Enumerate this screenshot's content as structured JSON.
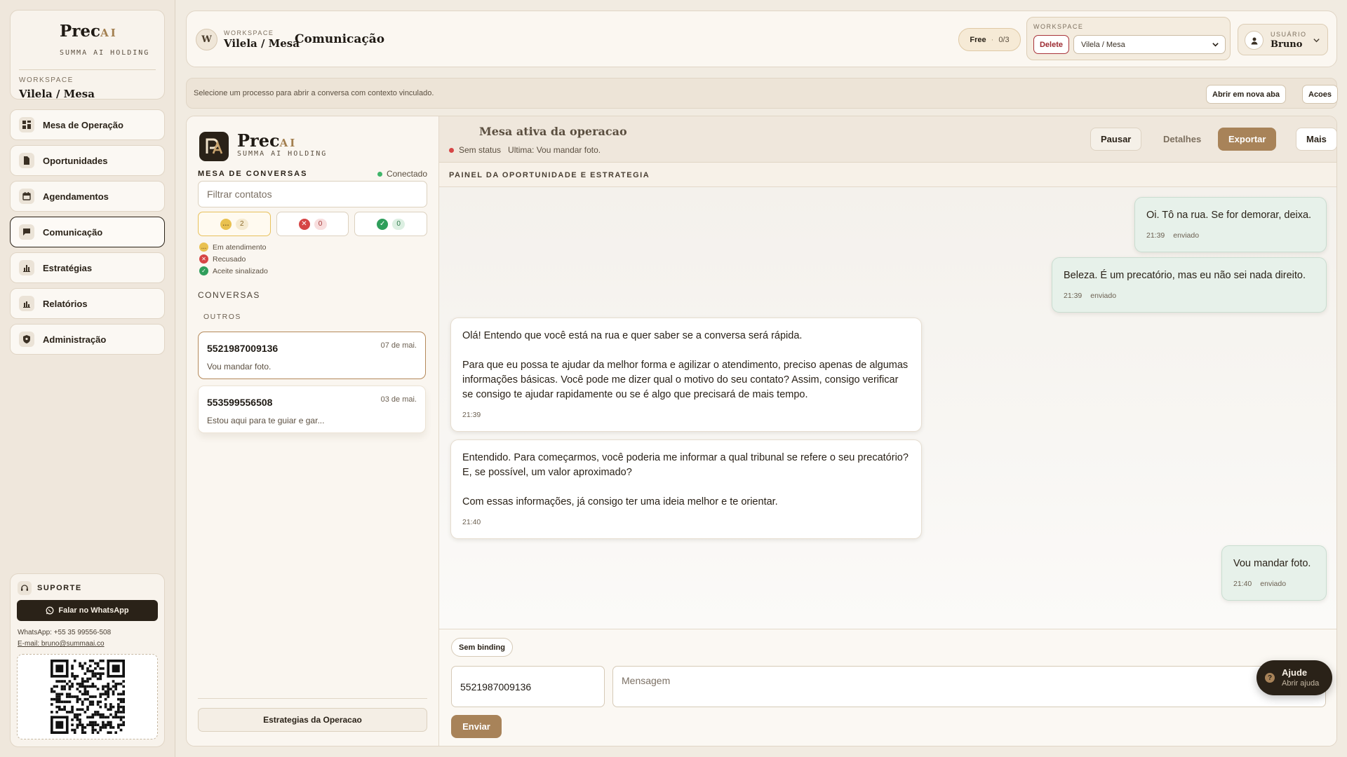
{
  "brand": {
    "name": "Prec",
    "name_ai": "AI",
    "subtitle": "SUMMA AI HOLDING",
    "workspace_label": "WORKSPACE",
    "workspace_name": "Vilela / Mesa"
  },
  "sidebar": {
    "items": [
      {
        "label": "Mesa de Operação",
        "icon": "grid-icon"
      },
      {
        "label": "Oportunidades",
        "icon": "document-icon"
      },
      {
        "label": "Agendamentos",
        "icon": "calendar-icon"
      },
      {
        "label": "Comunicação",
        "icon": "chat-icon",
        "active": true
      },
      {
        "label": "Estratégias",
        "icon": "chart-icon"
      },
      {
        "label": "Relatórios",
        "icon": "chart-icon"
      },
      {
        "label": "Administração",
        "icon": "shield-icon"
      }
    ]
  },
  "support": {
    "title": "SUPORTE",
    "whatsapp_button": "Falar no WhatsApp",
    "whatsapp_line": "WhatsApp: +55 35 99556-508",
    "email_line": "E-mail: bruno@summaai.co"
  },
  "topbar": {
    "avatar_letter": "W",
    "workspace_label": "WORKSPACE",
    "workspace_name": "Vilela / Mesa",
    "page_title": "Comunicação",
    "plan_name": "Free",
    "plan_dot": "·",
    "plan_usage": "0/3",
    "ws_box_label": "WORKSPACE",
    "delete_label": "Delete",
    "workspace_select": "Vilela / Mesa",
    "user_label": "USUÁRIO",
    "user_name": "Bruno"
  },
  "infobar": {
    "text": "Selecione um processo para abrir a conversa com contexto vinculado.",
    "open_new_tab": "Abrir em nova aba",
    "actions": "Acoes"
  },
  "conversations_panel": {
    "brand": "Prec",
    "brand_ai": "AI",
    "brand_sub": "SUMMA AI HOLDING",
    "title": "MESA DE CONVERSAS",
    "connection": "Conectado",
    "filter_placeholder": "Filtrar contatos",
    "status_tabs": [
      {
        "icon": "…",
        "count": "2",
        "color": "#e9c150",
        "count_bg": "#f5ead0",
        "count_fg": "#8a6a2a"
      },
      {
        "icon": "✕",
        "count": "0",
        "color": "#d64545",
        "count_bg": "#f8dede",
        "count_fg": "#a33a3a"
      },
      {
        "icon": "✓",
        "count": "0",
        "color": "#2f9e5b",
        "count_bg": "#dcefe2",
        "count_fg": "#2f7a4b"
      }
    ],
    "legend": [
      {
        "icon": "…",
        "label": "Em atendimento",
        "color": "#e9c150"
      },
      {
        "icon": "✕",
        "label": "Recusado",
        "color": "#d64545"
      },
      {
        "icon": "✓",
        "label": "Aceite sinalizado",
        "color": "#2f9e5b"
      }
    ],
    "section_title": "CONVERSAS",
    "group_title": "OUTROS",
    "items": [
      {
        "name": "5521987009136",
        "date": "07 de mai.",
        "preview": "Vou mandar foto."
      },
      {
        "name": "553599556508",
        "date": "03 de mai.",
        "preview": "Estou aqui para te guiar e gar..."
      }
    ],
    "strategies_button": "Estrategias da Operacao"
  },
  "chat": {
    "title": "Mesa ativa da operacao",
    "status": "Sem status",
    "last": "Ultima: Vou mandar foto.",
    "buttons": {
      "pause": "Pausar",
      "details": "Detalhes",
      "export": "Exportar",
      "more": "Mais"
    },
    "panel_strip": "PAINEL DA OPORTUNIDADE E ESTRATEGIA",
    "messages": [
      {
        "dir": "out",
        "text": "Oi. Tô na rua. Se for demorar, deixa.",
        "time": "21:39",
        "status": "enviado"
      },
      {
        "dir": "out",
        "text": "Beleza. É um precatório, mas eu não sei nada direito.",
        "time": "21:39",
        "status": "enviado"
      },
      {
        "dir": "in",
        "text": "Olá! Entendo que você está na rua e quer saber se a conversa será rápida.\n\nPara que eu possa te ajudar da melhor forma e agilizar o atendimento, preciso apenas de algumas informações básicas. Você pode me dizer qual o motivo do seu contato? Assim, consigo verificar se consigo te ajudar rapidamente ou se é algo que precisará de mais tempo.",
        "time": "21:39"
      },
      {
        "dir": "in",
        "text": "Entendido. Para começarmos, você poderia me informar a qual tribunal se refere o seu precatório? E, se possível, um valor aproximado?\n\nCom essas informações, já consigo ter uma ideia melhor e te orientar.",
        "time": "21:40"
      },
      {
        "dir": "out",
        "text": "Vou mandar foto.",
        "time": "21:40",
        "status": "enviado"
      }
    ],
    "binding": "Sem binding",
    "phone_value": "5521987009136",
    "message_placeholder": "Mensagem",
    "send": "Enviar"
  },
  "help": {
    "title": "Ajude",
    "subtitle": "Abrir ajuda"
  }
}
